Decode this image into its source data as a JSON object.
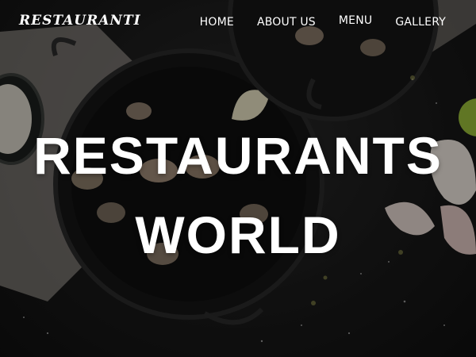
{
  "brand": {
    "logo_text": "RESTAURANTI"
  },
  "nav": {
    "items": [
      {
        "label": "HOME"
      },
      {
        "label": "ABOUT US"
      },
      {
        "label": "MENU"
      },
      {
        "label": "GALLERY"
      }
    ]
  },
  "hero": {
    "title_line1": "RESTAURANTS",
    "title_line2": "WORLD"
  },
  "colors": {
    "text": "#ffffff",
    "background": "#141414"
  }
}
